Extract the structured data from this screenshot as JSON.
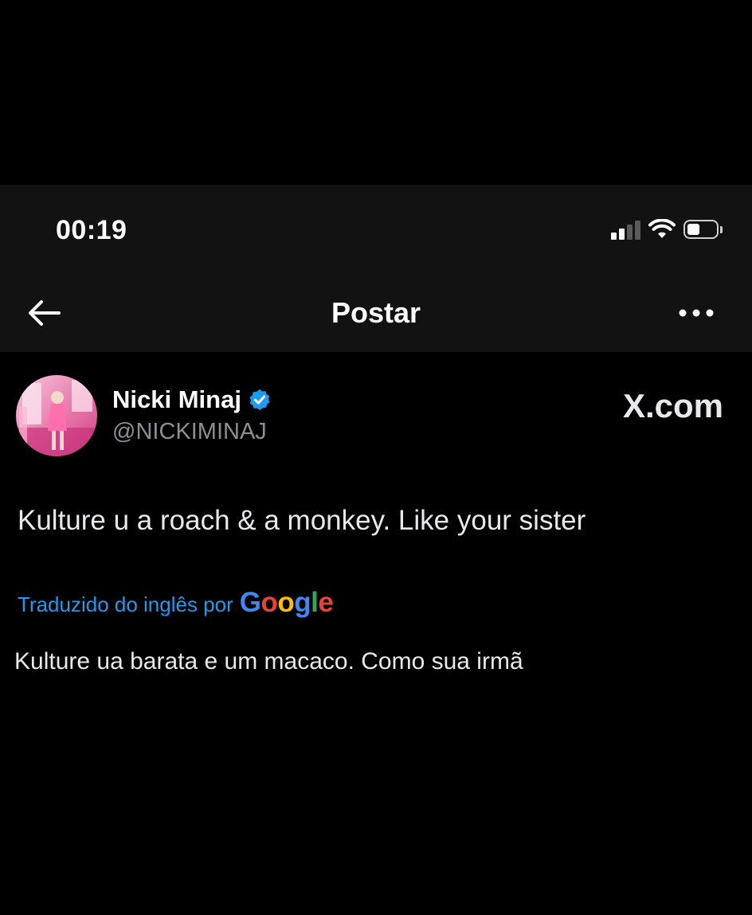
{
  "status_bar": {
    "time": "00:19"
  },
  "nav": {
    "title": "Postar",
    "back_icon": "arrow-left-icon",
    "more_icon": "more-horizontal-icon"
  },
  "post": {
    "author_name": "Nicki Minaj",
    "author_handle": "@NICKIMINAJ",
    "verified_icon": "verified-badge-icon",
    "verified_color": "#1d9bf0",
    "watermark": "X.com",
    "text": "Kulture u a roach & a monkey. Like your sister",
    "translation_label": "Traduzido do inglês por",
    "translation_provider": "Google",
    "translated_text": "Kulture ua barata e um macaco. Como sua irmã"
  },
  "colors": {
    "background": "#000000",
    "header": "#121212",
    "accent": "#1d9bf0",
    "secondary_text": "#8b8f94",
    "google_blue": "#4285F4",
    "google_red": "#EA4335",
    "google_yellow": "#FBBC05",
    "google_green": "#34A853"
  }
}
